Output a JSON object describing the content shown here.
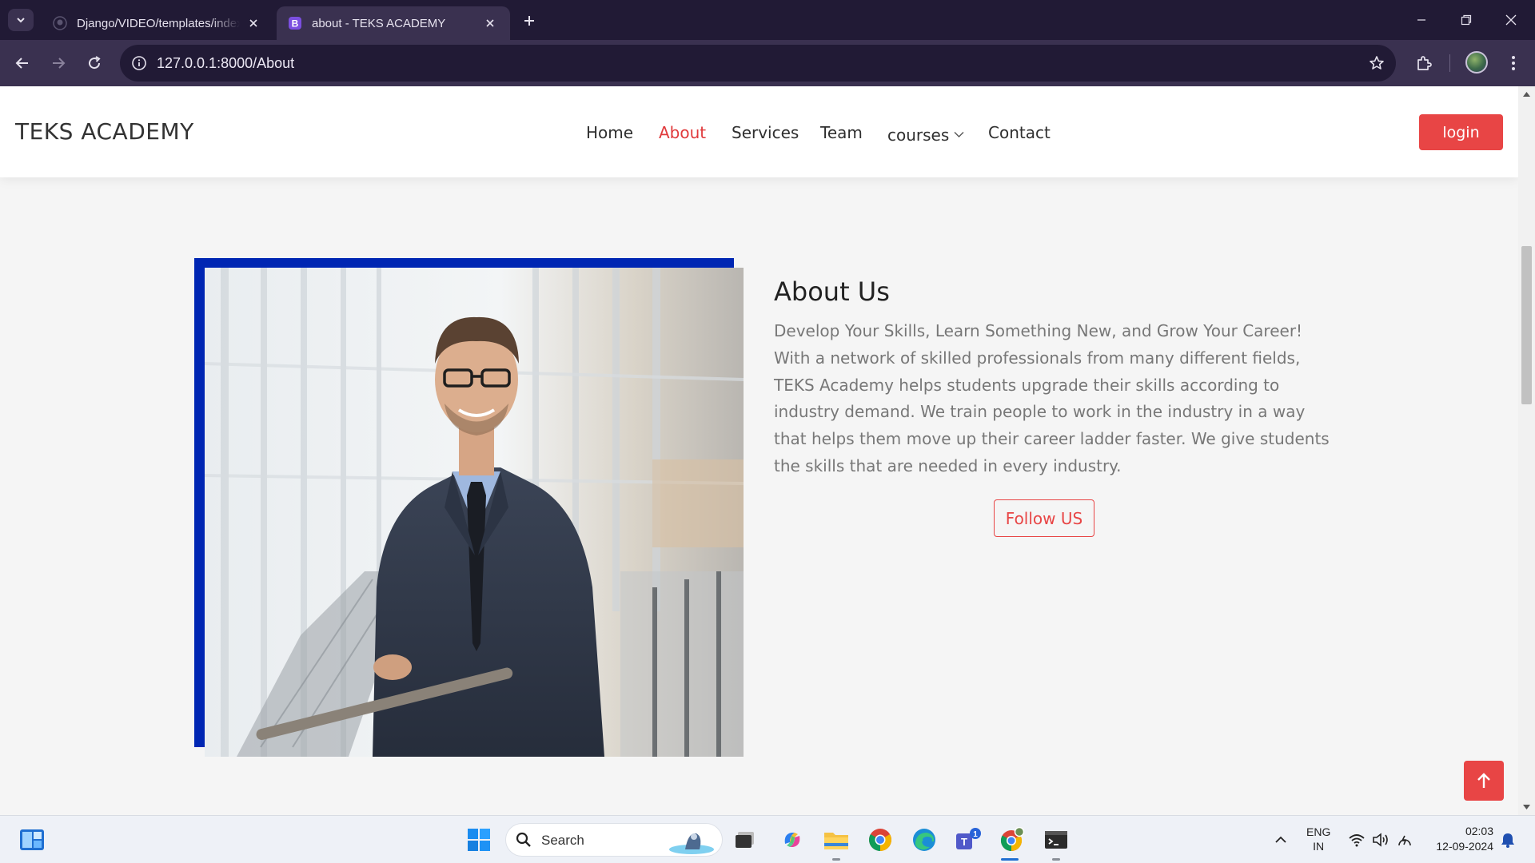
{
  "browser": {
    "tabs": [
      {
        "title": "Django/VIDEO/templates/index.html",
        "favicon": "github-icon",
        "active": false
      },
      {
        "title": "about - TEKS ACADEMY",
        "favicon": "bootstrap-icon",
        "active": true
      }
    ],
    "url": "127.0.0.1:8000/About"
  },
  "site": {
    "brand": "TEKS ACADEMY",
    "nav": [
      "Home",
      "About",
      "Services",
      "Team",
      "courses",
      "Contact"
    ],
    "active_nav": "About",
    "login_label": "login",
    "accent_color": "#e84545",
    "frame_color": "#0026b3"
  },
  "about": {
    "heading": "About Us",
    "body": "Develop Your Skills, Learn Something New, and Grow Your Career! With a network of skilled professionals from many different fields, TEKS Academy helps students upgrade their skills according to industry demand. We train people to work in the industry in a way that helps them move up their career ladder faster. We give students the skills that are needed in every industry.",
    "button": "Follow US",
    "image": "businessman-photo"
  },
  "taskbar": {
    "search_label": "Search",
    "lang_line1": "ENG",
    "lang_line2": "IN",
    "time": "02:03",
    "date": "12-09-2024",
    "teams_badge": "1"
  }
}
